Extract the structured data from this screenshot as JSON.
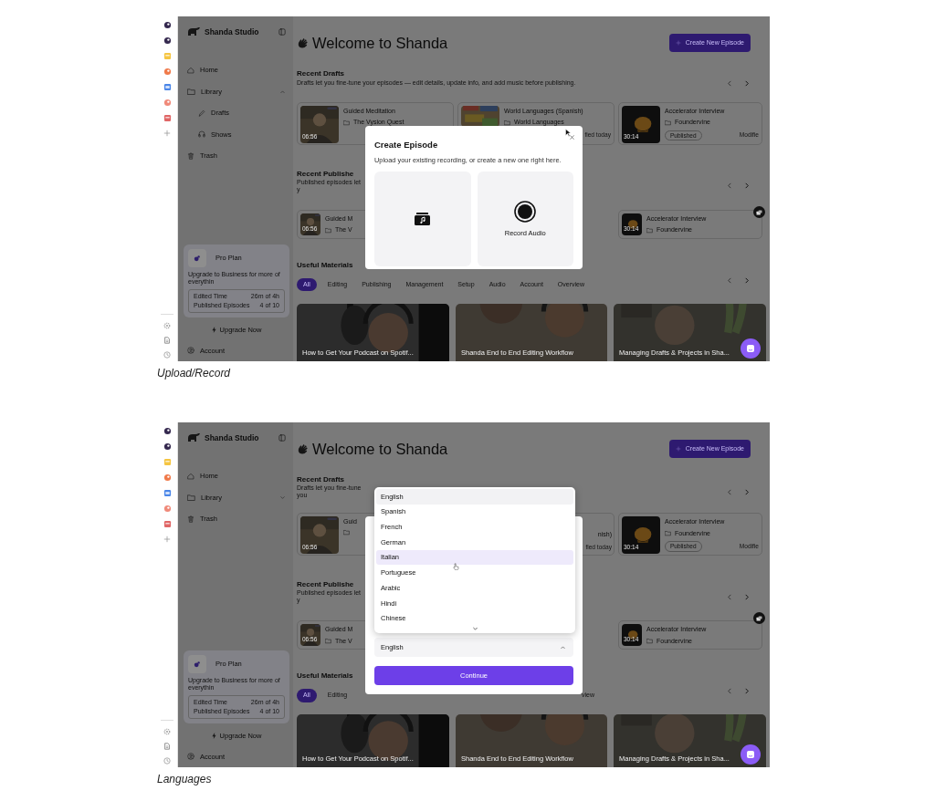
{
  "screens": [
    {
      "caption": "Upload/Record",
      "sidebar": {
        "brand": "Shanda Studio",
        "nav": [
          {
            "label": "Home"
          },
          {
            "label": "Library",
            "expanded": true,
            "children": [
              {
                "label": "Drafts"
              },
              {
                "label": "Shows"
              }
            ]
          },
          {
            "label": "Trash"
          }
        ],
        "plan": {
          "name": "Pro Plan",
          "text": "Upgrade to Business for more of everythin",
          "stats": [
            {
              "label": "Edited Time",
              "value": "26m of 4h"
            },
            {
              "label": "Published Episodes",
              "value": "4 of 10"
            }
          ],
          "upgrade": "Upgrade Now"
        },
        "account": "Account"
      },
      "main": {
        "title": "Welcome to Shanda",
        "create_button": "Create New Episode",
        "drafts": {
          "title": "Recent Drafts",
          "subtitle": "Drafts let you fine-tune your episodes — edit details, update info, and add music before publishing.",
          "cards": [
            {
              "kind": "card",
              "title": "Guided Meditation",
              "folder": "The Vysion Quest",
              "duration": "06:56"
            },
            {
              "kind": "card",
              "title": "World Languages (Spanish)",
              "folder": "World Languages",
              "modified": "fied today"
            },
            {
              "kind": "card",
              "title": "Accelerator Interview",
              "folder": "Foundervine",
              "duration": "30:14",
              "pill": "Published",
              "modified": "Modifie"
            }
          ]
        },
        "published": {
          "title": "Recent Publishe",
          "subtitle": "Published episodes let y",
          "cards": [
            {
              "kind": "card",
              "title": "Guided M",
              "folder": "The V",
              "duration": "06:56"
            },
            {
              "kind": "card",
              "title": "Accelerator Interview",
              "folder": "Foundervine",
              "duration": "30:14"
            }
          ]
        },
        "materials": {
          "title": "Useful Materials",
          "chips": [
            {
              "kind": "chip",
              "label": "All",
              "selected": true
            },
            {
              "kind": "chip",
              "label": "Editing",
              "selected": false
            },
            {
              "kind": "chip",
              "label": "Publishing",
              "selected": false
            },
            {
              "kind": "chip",
              "label": "Management",
              "selected": false
            },
            {
              "kind": "chip",
              "label": "Setup",
              "selected": false
            },
            {
              "kind": "chip",
              "label": "Audio",
              "selected": false
            },
            {
              "kind": "chip",
              "label": "Account",
              "selected": false
            },
            {
              "kind": "chip",
              "label": "Overview",
              "selected": false
            }
          ],
          "videos": [
            {
              "caption": "How to Get Your Podcast on Spotif..."
            },
            {
              "caption": "Shanda End to End Editing Workflow"
            },
            {
              "caption": "Managing Drafts & Projects in Sha..."
            }
          ]
        }
      },
      "modal": {
        "kind": "create",
        "title": "Create Episode",
        "subtitle": "Upload your existing recording, or create a new one right here.",
        "options": [
          {
            "kind": "upload"
          },
          {
            "kind": "record",
            "label": "Record Audio"
          }
        ]
      }
    },
    {
      "caption": "Languages",
      "sidebar": {
        "brand": "Shanda Studio",
        "nav": [
          {
            "label": "Home"
          },
          {
            "label": "Library",
            "expanded": false
          },
          {
            "label": "Trash"
          }
        ],
        "plan": {
          "name": "Pro Plan",
          "text": "Upgrade to Business for more of everythin",
          "stats": [
            {
              "label": "Edited Time",
              "value": "26m of 4h"
            },
            {
              "label": "Published Episodes",
              "value": "4 of 10"
            }
          ],
          "upgrade": "Upgrade Now"
        },
        "account": "Account"
      },
      "main": {
        "title": "Welcome to Shanda",
        "create_button": "Create New Episode",
        "drafts": {
          "title": "Recent Drafts",
          "subtitle": "Drafts let you fine-tune you",
          "cards": [
            {
              "kind": "card",
              "title": "Guid",
              "duration": "06:56"
            },
            {
              "kind": "fragment",
              "title": "nish)",
              "modified": "fied today"
            },
            {
              "kind": "card",
              "title": "Accelerator Interview",
              "folder": "Foundervine",
              "duration": "30:14",
              "pill": "Published",
              "modified": "Modifie"
            }
          ]
        },
        "published": {
          "title": "Recent Publishe",
          "subtitle": "Published episodes let y",
          "cards": [
            {
              "kind": "card",
              "title": "Guided M",
              "folder": "The V",
              "duration": "06:56"
            },
            {
              "kind": "card",
              "title": "Accelerator Interview",
              "folder": "Foundervine",
              "duration": "30:14"
            }
          ]
        },
        "materials": {
          "title": "Useful Materials",
          "chips": [
            {
              "kind": "chip",
              "label": "All",
              "selected": true
            },
            {
              "kind": "chip",
              "label": "Editing",
              "selected": false
            },
            {
              "kind": "fragment",
              "label": "view",
              "selected": false
            }
          ],
          "videos": [
            {
              "caption": "How to Get Your Podcast on Spotif..."
            },
            {
              "caption": "Shanda End to End Editing Workflow"
            },
            {
              "caption": "Managing Drafts & Projects in Sha..."
            }
          ]
        }
      },
      "modal": {
        "kind": "language",
        "options": [
          {
            "label": "English",
            "selected": true,
            "hovered": false
          },
          {
            "label": "Spanish",
            "selected": false,
            "hovered": false
          },
          {
            "label": "French",
            "selected": false,
            "hovered": false
          },
          {
            "label": "German",
            "selected": false,
            "hovered": false
          },
          {
            "label": "Italian",
            "selected": false,
            "hovered": true
          },
          {
            "label": "Portuguese",
            "selected": false,
            "hovered": false
          },
          {
            "label": "Arabic",
            "selected": false,
            "hovered": false
          },
          {
            "label": "Hindi",
            "selected": false,
            "hovered": false
          },
          {
            "label": "Chinese",
            "selected": false,
            "hovered": false
          }
        ],
        "select": {
          "value": "English",
          "expanded": true
        },
        "button": "Continue"
      }
    }
  ]
}
